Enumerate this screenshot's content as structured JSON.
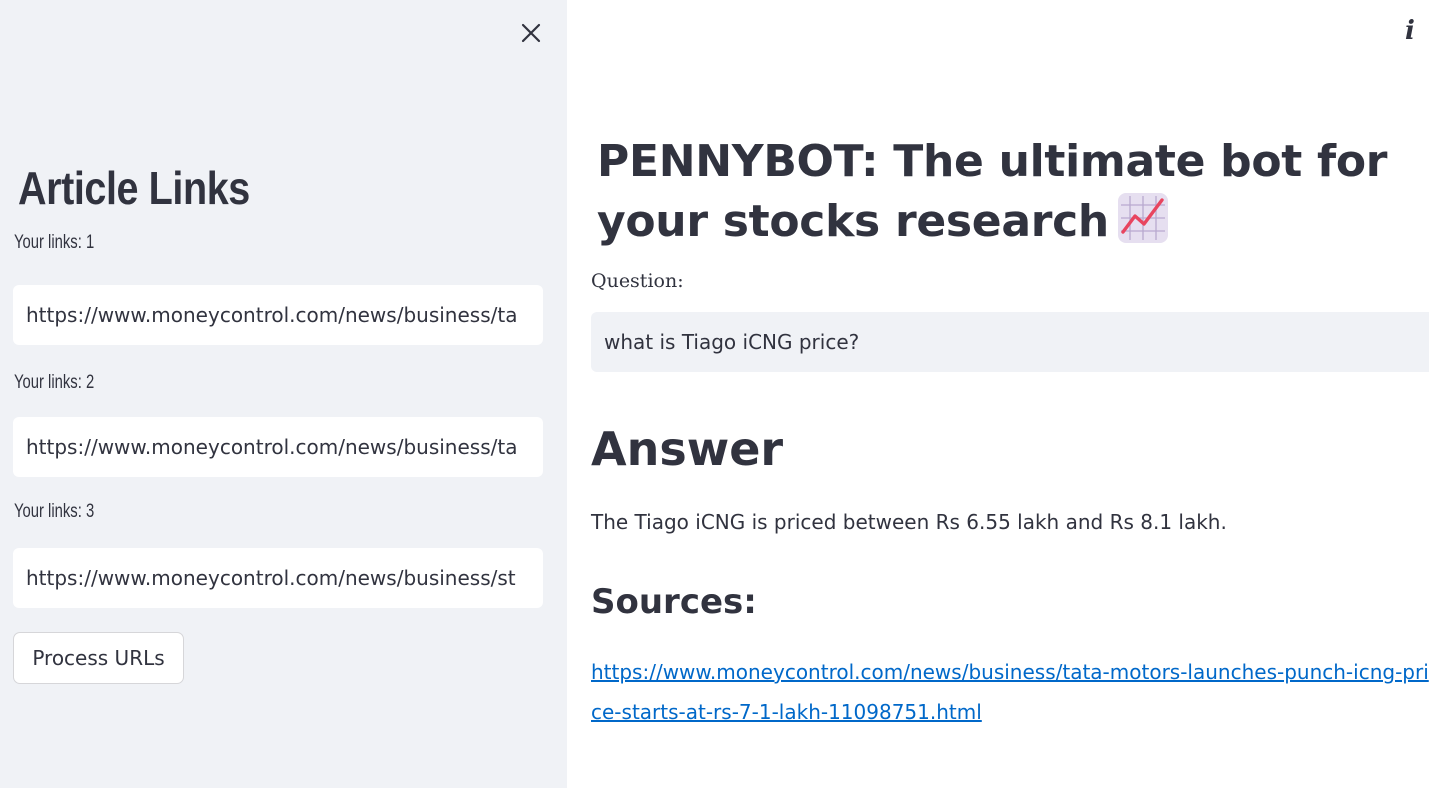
{
  "sidebar": {
    "title": "Article Links",
    "links": [
      {
        "label": "Your links: 1",
        "value": "https://www.moneycontrol.com/news/business/ta"
      },
      {
        "label": "Your links: 2",
        "value": "https://www.moneycontrol.com/news/business/ta"
      },
      {
        "label": "Your links: 3",
        "value": "https://www.moneycontrol.com/news/business/st"
      }
    ],
    "process_button": "Process URLs",
    "close_icon": "close-icon",
    "background": "#f0f2f6"
  },
  "main": {
    "title": "PENNYBOT: The ultimate bot for your stocks research",
    "title_icon": "chart-increasing-icon",
    "info_icon": "info-icon",
    "question_label": "Question:",
    "question_value": "what is Tiago iCNG price?",
    "answer_heading": "Answer",
    "answer_text": "The Tiago iCNG is priced between Rs 6.55 lakh and Rs 8.1 lakh.",
    "sources_heading": "Sources:",
    "source_link": "https://www.moneycontrol.com/news/business/tata-motors-launches-punch-icng-price-starts-at-rs-7-1-lakh-11098751.html",
    "link_color": "#0068c9"
  }
}
